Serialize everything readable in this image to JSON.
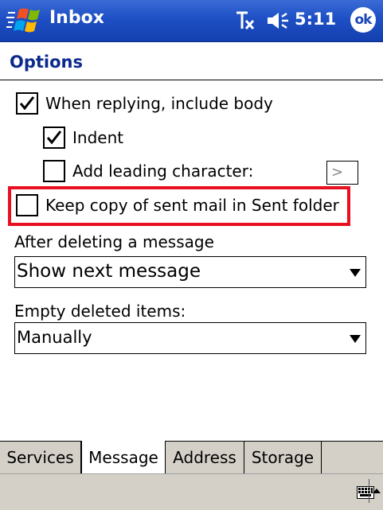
{
  "titlebar": {
    "app_title": "Inbox",
    "time": "5:11",
    "ok_label": "ok",
    "icons": [
      "windows-start-icon",
      "signal-off-icon",
      "speaker-icon"
    ]
  },
  "page": {
    "title": "Options"
  },
  "options": {
    "include_body": {
      "label": "When replying, include body",
      "checked": true
    },
    "indent": {
      "label": "Indent",
      "checked": true
    },
    "leading_char": {
      "label": "Add leading character:",
      "checked": false,
      "value": ">"
    },
    "keep_copy": {
      "label": "Keep copy of sent mail in Sent folder",
      "checked": false
    }
  },
  "after_delete": {
    "label": "After deleting a message",
    "selected": "Show next message"
  },
  "empty_deleted": {
    "label": "Empty deleted items:",
    "selected": "Manually"
  },
  "tabs": [
    {
      "label": "Services",
      "active": false
    },
    {
      "label": "Message",
      "active": true
    },
    {
      "label": "Address",
      "active": false
    },
    {
      "label": "Storage",
      "active": false
    }
  ],
  "colors": {
    "titlebar": "#1e4fc4",
    "heading": "#0b2a8c",
    "highlight": "#e81020",
    "chrome": "#d4d0c8"
  }
}
